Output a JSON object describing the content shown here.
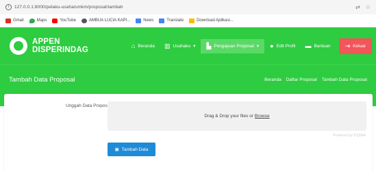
{
  "browser": {
    "url": "127.0.0.1:8000/pelaku-usaha/umkm/proposal/tambah"
  },
  "bookmarks": [
    {
      "label": "Gmail",
      "color": "#d93025"
    },
    {
      "label": "Maps",
      "color": "#34a853"
    },
    {
      "label": "YouTube",
      "color": "#ff0000"
    },
    {
      "label": "AMBUA LUCIA KAPI...",
      "color": "#555555"
    },
    {
      "label": "News",
      "color": "#4285f4"
    },
    {
      "label": "Translate",
      "color": "#4285f4"
    },
    {
      "label": "Download Aplikasi...",
      "color": "#fbbc04"
    }
  ],
  "brand": {
    "line1": "APPEN",
    "line2": "DISPERINDAG"
  },
  "nav": {
    "beranda": "Beranda",
    "usahaku": "Usahaku",
    "pengajuan": "Pengajuan Proposal",
    "edit_profil": "Edit Profil",
    "bantuan": "Bantuan",
    "keluar": "Keluar"
  },
  "page": {
    "title": "Tambah Data Proposal",
    "breadcrumb": [
      "Beranda",
      "Daftar Proposal",
      "Tambah Data Proposal"
    ]
  },
  "form": {
    "upload_label": "Unggah Data Proposal",
    "dropzone_text": "Drag & Drop your files or",
    "dropzone_link": "Browse",
    "powered_by": "Powered by PQINA",
    "submit_label": "Tambah Data"
  },
  "colors": {
    "primary_green": "#2ecc40",
    "active_nav": "#5ad966",
    "logout_red": "#f2555a",
    "button_blue": "#1f8bd8"
  }
}
